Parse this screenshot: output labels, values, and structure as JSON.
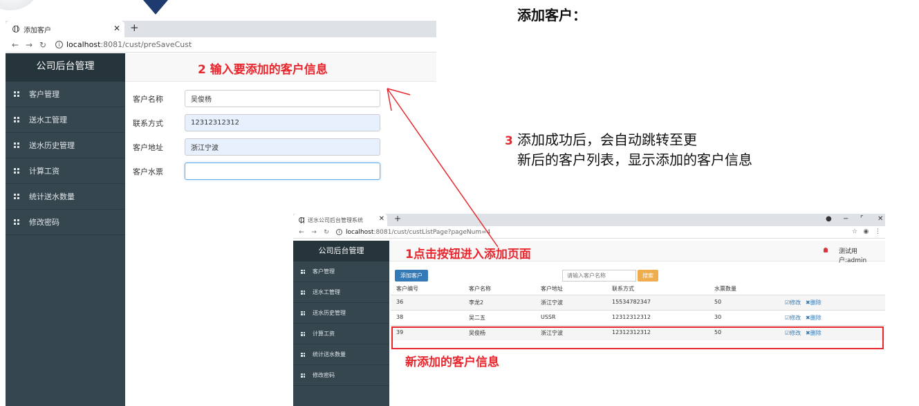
{
  "slide": {
    "title": "添加客户：",
    "annotation_step2": "2 输入要添加的客户信息",
    "annotation_step1": "1点击按钮进入添加页面",
    "annotation_step3_num": "3",
    "annotation_step3_line1": "添加成功后，会自动跳转至更",
    "annotation_step3_line2": "新后的客户列表，显示添加的客户信息",
    "annotation_new": "新添加的客户信息",
    "accent_color": "#e8262d"
  },
  "browser1": {
    "tab_title": "添加客户",
    "url_host": "localhost",
    "url_path": ":8081/cust/preSaveCust",
    "sidebar": {
      "title": "公司后台管理",
      "items": [
        {
          "label": "客户管理"
        },
        {
          "label": "送水工管理"
        },
        {
          "label": "送水历史管理"
        },
        {
          "label": "计算工资"
        },
        {
          "label": "统计送水数量"
        },
        {
          "label": "修改密码"
        }
      ]
    },
    "form": {
      "name_label": "客户名称",
      "name_value": "吴俊杨",
      "contact_label": "联系方式",
      "contact_value": "12312312312",
      "address_label": "客户地址",
      "address_value": "浙江宁波",
      "tickets_label": "客户水票",
      "tickets_value": ""
    }
  },
  "browser2": {
    "tab_title": "送水公司后台管理系统",
    "url_host": "localhost",
    "url_path": ":8081/cust/custListPage?pageNum=4",
    "user_label": "测试用户:admin",
    "sidebar": {
      "title": "公司后台管理",
      "items": [
        {
          "label": "客户管理"
        },
        {
          "label": "送水工管理"
        },
        {
          "label": "送水历史管理"
        },
        {
          "label": "计算工资"
        },
        {
          "label": "统计送水数量"
        },
        {
          "label": "修改密码"
        }
      ]
    },
    "toolbar": {
      "add_label": "添加客户",
      "search_placeholder": "请输入客户名称",
      "search_label": "搜索"
    },
    "table": {
      "headers": [
        "客户编号",
        "客户名称",
        "客户地址",
        "联系方式",
        "水票数量"
      ],
      "edit_label": "修改",
      "delete_label": "删除",
      "rows": [
        {
          "id": "36",
          "name": "李龙2",
          "address": "浙江宁波",
          "phone": "15534782347",
          "tickets": "50"
        },
        {
          "id": "38",
          "name": "吴二五",
          "address": "USSR",
          "phone": "12312312312",
          "tickets": "30"
        },
        {
          "id": "39",
          "name": "吴俊杨",
          "address": "浙江宁波",
          "phone": "12312312312",
          "tickets": "50"
        }
      ]
    }
  }
}
